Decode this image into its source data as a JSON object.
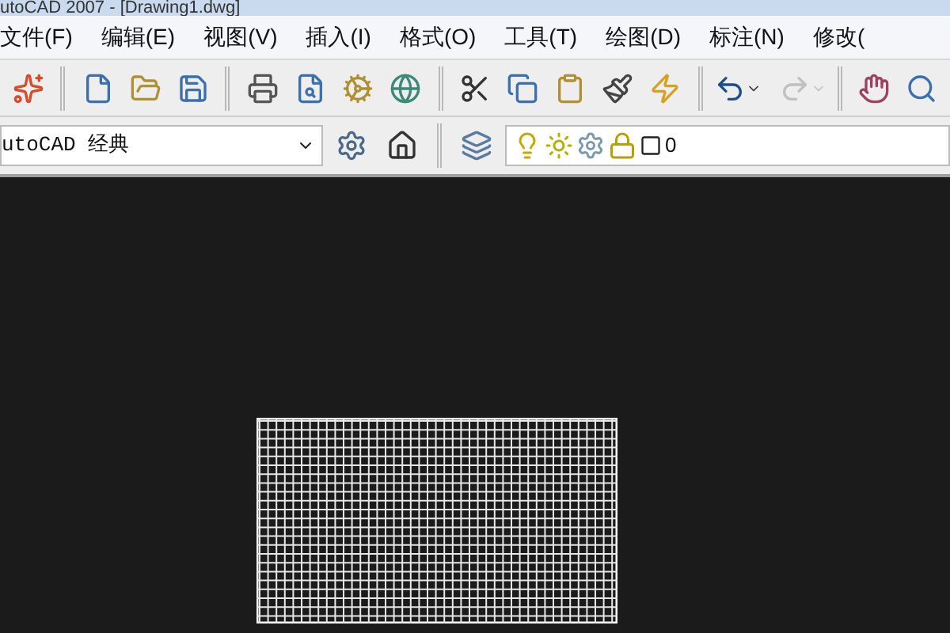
{
  "window": {
    "title": "utoCAD 2007 - [Drawing1.dwg]"
  },
  "menu": [
    "文件(F)",
    "编辑(E)",
    "视图(V)",
    "插入(I)",
    "格式(O)",
    "工具(T)",
    "绘图(D)",
    "标注(N)",
    "修改("
  ],
  "toolbar": {
    "undo": {
      "disabled": false
    },
    "redo": {
      "disabled": true
    }
  },
  "workspace": {
    "value": "utoCAD 经典"
  },
  "layer": {
    "name": "0"
  }
}
